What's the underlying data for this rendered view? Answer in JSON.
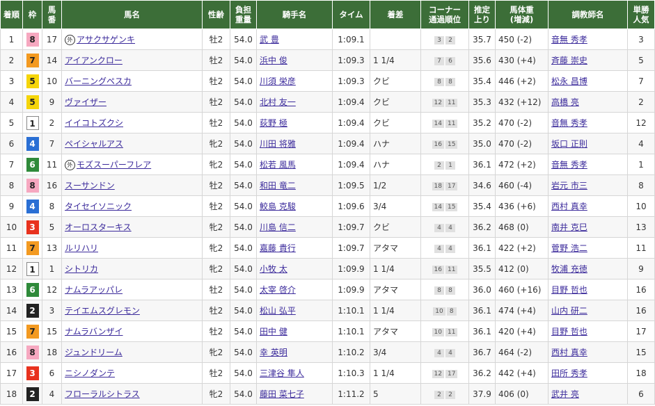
{
  "headers": {
    "rank": "着順",
    "waku": "枠",
    "umaban": "馬\n番",
    "horse": "馬名",
    "sexage": "性齢",
    "weight": "負担\n重量",
    "jockey": "騎手名",
    "time": "タイム",
    "margin": "着差",
    "corner": "コーナー\n通過順位",
    "last3f": "推定\n上り",
    "bodyweight": "馬体重\n(増減)",
    "trainer": "調教師名",
    "pop": "単勝\n人気"
  },
  "foreign_mark": "外",
  "rows": [
    {
      "rank": "1",
      "waku": "8",
      "umaban": "17",
      "horse": "アサクサゲンキ",
      "foreign": true,
      "sexage": "牡2",
      "weight": "54.0",
      "jockey": "武 豊",
      "time": "1:09.1",
      "margin": "",
      "corner": [
        "3",
        "2"
      ],
      "last3f": "35.7",
      "bodyweight": "450 (-2)",
      "trainer": "音無 秀孝",
      "pop": "3"
    },
    {
      "rank": "2",
      "waku": "7",
      "umaban": "14",
      "horse": "アイアンクロー",
      "foreign": false,
      "sexage": "牡2",
      "weight": "54.0",
      "jockey": "浜中 俊",
      "time": "1:09.3",
      "margin": "1 1/4",
      "corner": [
        "7",
        "6"
      ],
      "last3f": "35.6",
      "bodyweight": "430 (+4)",
      "trainer": "斉藤 崇史",
      "pop": "5"
    },
    {
      "rank": "3",
      "waku": "5",
      "umaban": "10",
      "horse": "バーニングペスカ",
      "foreign": false,
      "sexage": "牡2",
      "weight": "54.0",
      "jockey": "川須 栄彦",
      "time": "1:09.3",
      "margin": "クビ",
      "corner": [
        "8",
        "8"
      ],
      "last3f": "35.4",
      "bodyweight": "446 (+2)",
      "trainer": "松永 昌博",
      "pop": "7"
    },
    {
      "rank": "4",
      "waku": "5",
      "umaban": "9",
      "horse": "ヴァイザー",
      "foreign": false,
      "sexage": "牡2",
      "weight": "54.0",
      "jockey": "北村 友一",
      "time": "1:09.4",
      "margin": "クビ",
      "corner": [
        "12",
        "11"
      ],
      "last3f": "35.3",
      "bodyweight": "432 (+12)",
      "trainer": "高橋 亮",
      "pop": "2"
    },
    {
      "rank": "5",
      "waku": "1",
      "umaban": "2",
      "horse": "イイコトズクシ",
      "foreign": false,
      "sexage": "牡2",
      "weight": "54.0",
      "jockey": "荻野 極",
      "time": "1:09.4",
      "margin": "クビ",
      "corner": [
        "14",
        "11"
      ],
      "last3f": "35.2",
      "bodyweight": "470 (-2)",
      "trainer": "音無 秀孝",
      "pop": "12"
    },
    {
      "rank": "6",
      "waku": "4",
      "umaban": "7",
      "horse": "ペイシャルアス",
      "foreign": false,
      "sexage": "牝2",
      "weight": "54.0",
      "jockey": "川田 将雅",
      "time": "1:09.4",
      "margin": "ハナ",
      "corner": [
        "16",
        "15"
      ],
      "last3f": "35.0",
      "bodyweight": "470 (-2)",
      "trainer": "坂口 正則",
      "pop": "4"
    },
    {
      "rank": "7",
      "waku": "6",
      "umaban": "11",
      "horse": "モズスーパーフレア",
      "foreign": true,
      "sexage": "牝2",
      "weight": "54.0",
      "jockey": "松若 風馬",
      "time": "1:09.4",
      "margin": "ハナ",
      "corner": [
        "2",
        "1"
      ],
      "last3f": "36.1",
      "bodyweight": "472 (+2)",
      "trainer": "音無 秀孝",
      "pop": "1"
    },
    {
      "rank": "8",
      "waku": "8",
      "umaban": "16",
      "horse": "スーサンドン",
      "foreign": false,
      "sexage": "牡2",
      "weight": "54.0",
      "jockey": "和田 竜二",
      "time": "1:09.5",
      "margin": "1/2",
      "corner": [
        "18",
        "17"
      ],
      "last3f": "34.6",
      "bodyweight": "460 (-4)",
      "trainer": "岩元 市三",
      "pop": "8"
    },
    {
      "rank": "9",
      "waku": "4",
      "umaban": "8",
      "horse": "タイセイソニック",
      "foreign": false,
      "sexage": "牡2",
      "weight": "54.0",
      "jockey": "鮫島 克駿",
      "time": "1:09.6",
      "margin": "3/4",
      "corner": [
        "14",
        "15"
      ],
      "last3f": "35.4",
      "bodyweight": "436 (+6)",
      "trainer": "西村 真幸",
      "pop": "10"
    },
    {
      "rank": "10",
      "waku": "3",
      "umaban": "5",
      "horse": "オーロスターキス",
      "foreign": false,
      "sexage": "牝2",
      "weight": "54.0",
      "jockey": "川島 信二",
      "time": "1:09.7",
      "margin": "クビ",
      "corner": [
        "4",
        "4"
      ],
      "last3f": "36.2",
      "bodyweight": "468 (0)",
      "trainer": "南井 克巳",
      "pop": "13"
    },
    {
      "rank": "11",
      "waku": "7",
      "umaban": "13",
      "horse": "ルリハリ",
      "foreign": false,
      "sexage": "牝2",
      "weight": "54.0",
      "jockey": "嘉藤 貴行",
      "time": "1:09.7",
      "margin": "アタマ",
      "corner": [
        "4",
        "4"
      ],
      "last3f": "36.1",
      "bodyweight": "422 (+2)",
      "trainer": "菅野 浩二",
      "pop": "11"
    },
    {
      "rank": "12",
      "waku": "1",
      "umaban": "1",
      "horse": "シトリカ",
      "foreign": false,
      "sexage": "牝2",
      "weight": "54.0",
      "jockey": "小牧 太",
      "time": "1:09.9",
      "margin": "1 1/4",
      "corner": [
        "16",
        "11"
      ],
      "last3f": "35.5",
      "bodyweight": "412 (0)",
      "trainer": "牧浦 充徳",
      "pop": "9"
    },
    {
      "rank": "13",
      "waku": "6",
      "umaban": "12",
      "horse": "ナムラアッパレ",
      "foreign": false,
      "sexage": "牡2",
      "weight": "54.0",
      "jockey": "太宰 啓介",
      "time": "1:09.9",
      "margin": "アタマ",
      "corner": [
        "8",
        "8"
      ],
      "last3f": "36.0",
      "bodyweight": "460 (+16)",
      "trainer": "目野 哲也",
      "pop": "16"
    },
    {
      "rank": "14",
      "waku": "2",
      "umaban": "3",
      "horse": "テイエムスグレモン",
      "foreign": false,
      "sexage": "牡2",
      "weight": "54.0",
      "jockey": "松山 弘平",
      "time": "1:10.1",
      "margin": "1 1/4",
      "corner": [
        "10",
        "8"
      ],
      "last3f": "36.1",
      "bodyweight": "474 (+4)",
      "trainer": "山内 研二",
      "pop": "16"
    },
    {
      "rank": "15",
      "waku": "7",
      "umaban": "15",
      "horse": "ナムラバンザイ",
      "foreign": false,
      "sexage": "牡2",
      "weight": "54.0",
      "jockey": "田中 健",
      "time": "1:10.1",
      "margin": "アタマ",
      "corner": [
        "10",
        "11"
      ],
      "last3f": "36.1",
      "bodyweight": "420 (+4)",
      "trainer": "目野 哲也",
      "pop": "17"
    },
    {
      "rank": "16",
      "waku": "8",
      "umaban": "18",
      "horse": "ジュンドリーム",
      "foreign": false,
      "sexage": "牝2",
      "weight": "54.0",
      "jockey": "幸 英明",
      "time": "1:10.2",
      "margin": "3/4",
      "corner": [
        "4",
        "4"
      ],
      "last3f": "36.7",
      "bodyweight": "464 (-2)",
      "trainer": "西村 真幸",
      "pop": "15"
    },
    {
      "rank": "17",
      "waku": "3",
      "umaban": "6",
      "horse": "ニシノダンテ",
      "foreign": false,
      "sexage": "牡2",
      "weight": "54.0",
      "jockey": "三津谷 隼人",
      "time": "1:10.3",
      "margin": "1 1/4",
      "corner": [
        "12",
        "17"
      ],
      "last3f": "36.2",
      "bodyweight": "442 (+4)",
      "trainer": "田所 秀孝",
      "pop": "18"
    },
    {
      "rank": "18",
      "waku": "2",
      "umaban": "4",
      "horse": "フローラルシトラス",
      "foreign": false,
      "sexage": "牝2",
      "weight": "54.0",
      "jockey": "藤田 菜七子",
      "time": "1:11.2",
      "margin": "5",
      "corner": [
        "2",
        "2"
      ],
      "last3f": "37.9",
      "bodyweight": "406 (0)",
      "trainer": "武井 亮",
      "pop": "6"
    }
  ]
}
